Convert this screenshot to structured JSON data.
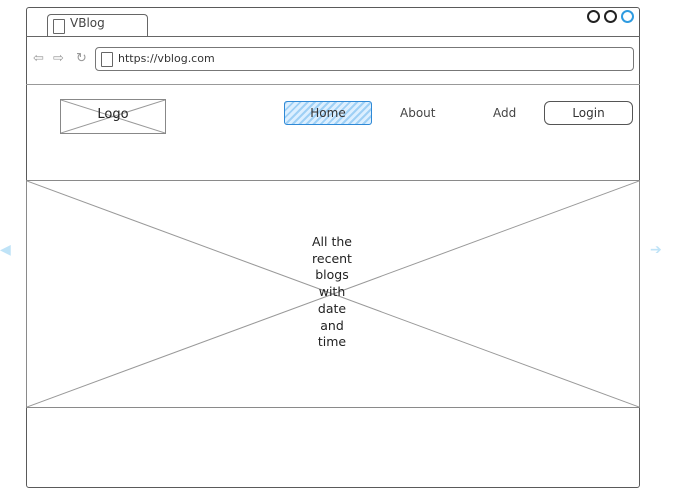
{
  "browser": {
    "tab_title": "VBlog",
    "url": "https://vblog.com",
    "nav_icons": [
      "back-arrow-icon",
      "forward-arrow-icon",
      "refresh-icon"
    ]
  },
  "header": {
    "logo_label": "Logo",
    "nav": {
      "home": "Home",
      "about": "About",
      "add": "Add",
      "login": "Login"
    },
    "active_item": "Home"
  },
  "main": {
    "placeholder_lines": [
      "All the",
      "recent",
      "blogs",
      "with",
      "date",
      "and",
      "time"
    ]
  },
  "colors": {
    "accent": "#2f89d6",
    "active_fill": "#9fd0f5",
    "side_arrows": "#bfe3f7"
  }
}
